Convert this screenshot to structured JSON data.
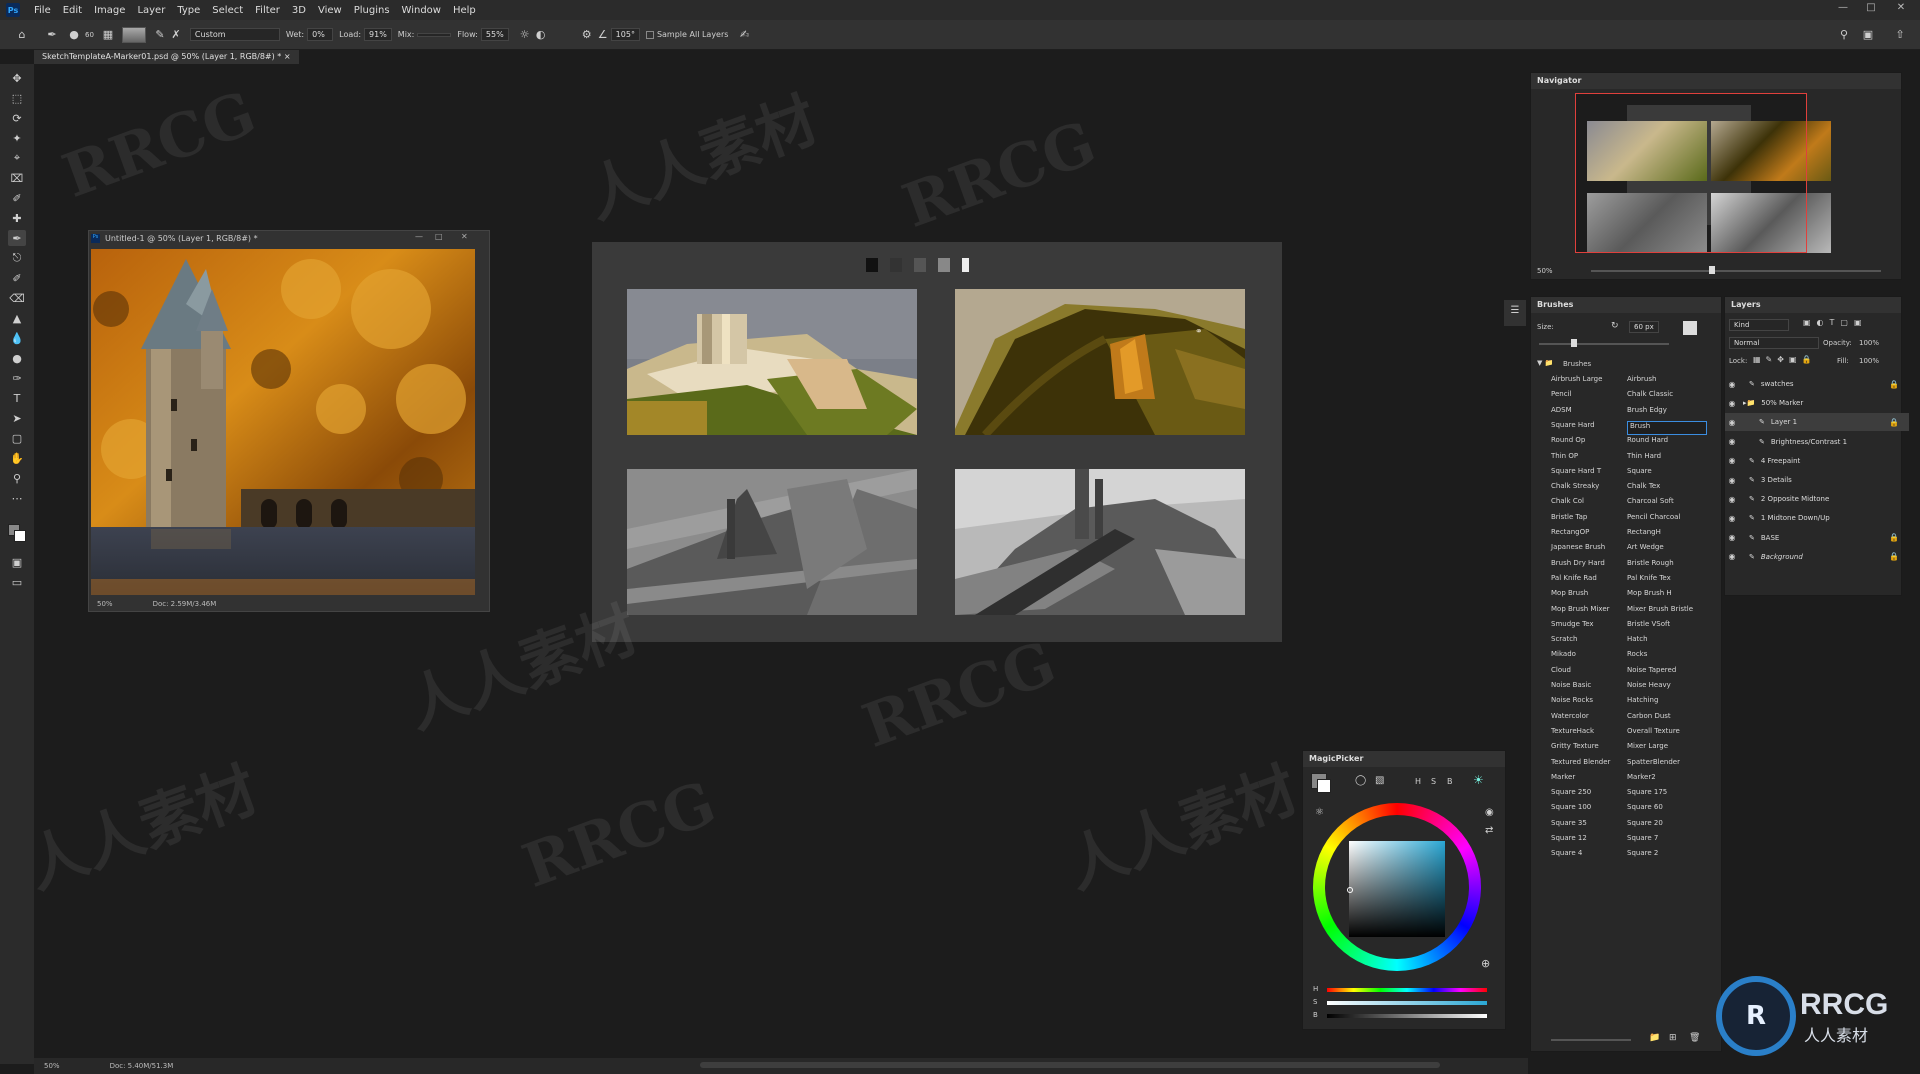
{
  "menubar": {
    "logo": "Ps",
    "items": [
      "File",
      "Edit",
      "Image",
      "Layer",
      "Type",
      "Select",
      "Filter",
      "3D",
      "View",
      "Plugins",
      "Window",
      "Help"
    ]
  },
  "options": {
    "preset": "Custom",
    "wet_label": "Wet:",
    "wet_value": "0%",
    "load_label": "Load:",
    "load_value": "91%",
    "mix_label": "Mix:",
    "flow_label": "Flow:",
    "flow_value": "55%",
    "angle_value": "105°",
    "sample_all_layers": "Sample All Layers",
    "brush_size": "60"
  },
  "document_tab": "SketchTemplateA-Marker01.psd @ 50% (Layer 1, RGB/8#) *",
  "photo_window": {
    "title": "Untitled-1 @ 50% (Layer 1, RGB/8#) *",
    "zoom": "50%",
    "doc_size": "Doc: 2.59M/3.46M"
  },
  "status_bar": {
    "zoom": "50%",
    "doc_size": "Doc: 5.40M/51.3M"
  },
  "navigator": {
    "title": "Navigator",
    "zoom": "50%"
  },
  "brushes_panel": {
    "title": "Brushes",
    "size_label": "Size:",
    "size_value": "60 px",
    "folder": "Brushes",
    "left_col": [
      "Airbrush Large",
      "Pencil",
      "ADSM",
      "Square Hard",
      "Round Op",
      "Thin OP",
      "Square Hard T",
      "Chalk Streaky",
      "Chalk Col",
      "Bristle Tap",
      "RectangOP",
      "Japanese Brush",
      "Brush Dry Hard",
      "Pal Knife Rad",
      "Mop Brush",
      "Mop Brush Mixer",
      "Smudge Tex",
      "Scratch",
      "Mikado",
      "Cloud",
      "Noise Basic",
      "Noise Rocks",
      "Watercolor",
      "TextureHack",
      "Gritty Texture",
      "Textured Blender",
      "Marker",
      "Square 250",
      "Square 100",
      "Square 35",
      "Square 12",
      "Square 4"
    ],
    "right_col": [
      "Airbrush",
      "Chalk Classic",
      "Brush Edgy",
      "Brush",
      "Round Hard",
      "Thin Hard",
      "Square",
      "Chalk Tex",
      "Charcoal Soft",
      "Pencil Charcoal",
      "RectangH",
      "Art Wedge",
      "Bristle Rough",
      "Pal Knife Tex",
      "Mop Brush H",
      "Mixer Brush Bristle",
      "Bristle VSoft",
      "Hatch",
      "Rocks",
      "Noise Tapered",
      "Noise Heavy",
      "Hatching",
      "Carbon Dust",
      "Overall Texture",
      "Mixer Large",
      "SpatterBlender",
      "Marker2",
      "Square 175",
      "Square 60",
      "Square 20",
      "Square 7",
      "Square 2"
    ],
    "selected_right_index": 3
  },
  "layers_panel": {
    "title": "Layers",
    "kind": "Kind",
    "blend_mode": "Normal",
    "opacity_label": "Opacity:",
    "opacity_value": "100%",
    "lock_label": "Lock:",
    "fill_label": "Fill:",
    "fill_value": "100%",
    "layers": [
      {
        "name": "swatches",
        "locked": true
      },
      {
        "name": "50% Marker",
        "locked": false
      },
      {
        "name": "Layer 1",
        "locked": true
      },
      {
        "name": "Brightness/Contrast 1",
        "locked": false
      },
      {
        "name": "4 Freepaint",
        "locked": false
      },
      {
        "name": "3 Details",
        "locked": false
      },
      {
        "name": "2 Opposite Midtone",
        "locked": false
      },
      {
        "name": "1 Midtone Down/Up",
        "locked": false
      },
      {
        "name": "BASE",
        "locked": true
      },
      {
        "name": "Background",
        "locked": true
      }
    ]
  },
  "magicpicker": {
    "title": "MagicPicker",
    "mode_letters": [
      "H",
      "S",
      "B"
    ],
    "slider_labels": [
      "H",
      "S",
      "B"
    ]
  },
  "watermarks": {
    "text_a": "RRCG",
    "text_b": "人人素材",
    "logo_text": "RRCG",
    "logo_sub": "人人素材"
  },
  "colors": {
    "accent_blue": "#3b8de0",
    "navigator_frame": "#e0403c",
    "panel_bg": "#282828"
  }
}
